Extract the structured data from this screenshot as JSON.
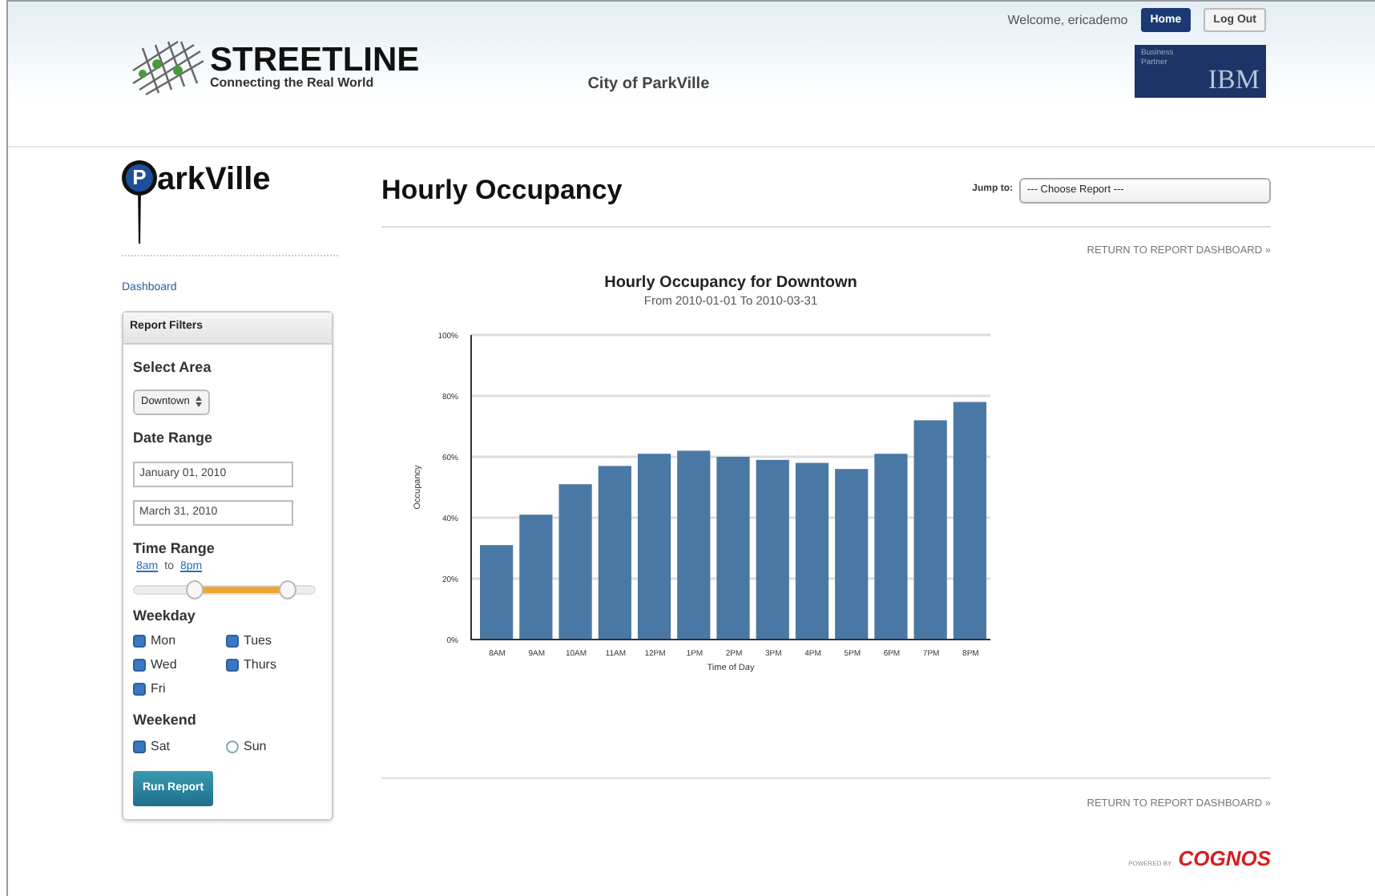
{
  "header": {
    "brand": "STREETLINE",
    "tagline": "Connecting the Real World",
    "city": "City of ParkVille",
    "welcome": "Welcome, ericademo",
    "buttons": [
      {
        "label": "Home",
        "selected": true
      },
      {
        "label": "Log Out",
        "selected": false
      }
    ],
    "partner": {
      "line1": "Business",
      "line2": "Partner",
      "mark": "IBM"
    }
  },
  "sidebar": {
    "logo": {
      "pin_letter": "P",
      "text": "arkVille"
    },
    "link": "Dashboard",
    "panel_title": "Report Filters",
    "area": {
      "label": "Select Area",
      "value": "Downtown"
    },
    "dates": {
      "label": "Date Range",
      "from": "January 01, 2010",
      "to": "March 31, 2010"
    },
    "time": {
      "label": "Time Range",
      "start": "8am",
      "sep": "to",
      "end": "8pm",
      "thumbs": [
        {
          "level": 0.33
        },
        {
          "level": 0.85
        }
      ]
    },
    "weekday": {
      "label": "Weekday",
      "days": [
        {
          "label": "Mon",
          "checked": true
        },
        {
          "label": "Tues",
          "checked": true
        },
        {
          "label": "Wed",
          "checked": true
        },
        {
          "label": "Thurs",
          "checked": true
        },
        {
          "label": "Fri",
          "checked": true
        }
      ]
    },
    "weekend": {
      "label": "Weekend",
      "days": [
        {
          "label": "Sat",
          "checked": true
        },
        {
          "label": "Sun",
          "checked": false
        }
      ]
    },
    "run": "Run Report"
  },
  "main": {
    "title": "Hourly Occupancy",
    "jump_label": "Jump to:",
    "jump_value": "--- Choose Report ---",
    "return_top": "RETURN TO REPORT DASHBOARD »",
    "return_bottom": "RETURN TO REPORT DASHBOARD »",
    "chart_data": {
      "type": "bar",
      "title": "Hourly Occupancy for Downtown",
      "subtitle": "From 2010-01-01 To 2010-03-31",
      "xlabel": "Time of Day",
      "ylabel": "Occupancy",
      "categories": [
        "8AM",
        "9AM",
        "10AM",
        "11AM",
        "12PM",
        "1PM",
        "2PM",
        "3PM",
        "4PM",
        "5PM",
        "6PM",
        "7PM",
        "8PM"
      ],
      "grid": true,
      "series": [
        {
          "color": "#4a78a4",
          "values": [
            31,
            41,
            51,
            57,
            61,
            62,
            60,
            59,
            58,
            56,
            61,
            72,
            78
          ]
        }
      ],
      "ylim": [
        0,
        100
      ],
      "yticks": [
        {
          "value": 0,
          "label": "0%"
        },
        {
          "value": 20,
          "label": "20%"
        },
        {
          "value": 40,
          "label": "40%"
        },
        {
          "value": 60,
          "label": "60%"
        },
        {
          "value": 80,
          "label": "80%"
        },
        {
          "value": 100,
          "label": "100%"
        }
      ]
    }
  },
  "footer": {
    "powered": "POWERED BY",
    "brand": "COGNOS"
  }
}
